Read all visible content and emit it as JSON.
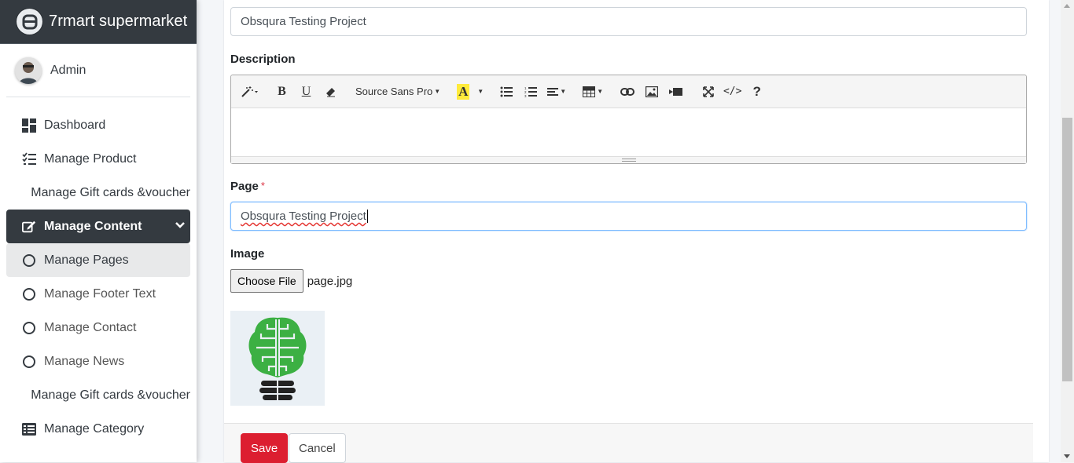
{
  "brand": {
    "name": "7rmart supermarket",
    "logo_icon": "brand-logo-icon"
  },
  "user": {
    "name": "Admin"
  },
  "sidebar": {
    "items": [
      {
        "label": "Dashboard",
        "icon": "dashboard-icon"
      },
      {
        "label": "Manage Product",
        "icon": "tasks-icon"
      },
      {
        "label": "Manage Gift cards &voucher",
        "icon": ""
      },
      {
        "label": "Manage Content",
        "icon": "edit-icon",
        "open": true
      },
      {
        "label": "Manage Pages",
        "icon": "circle-icon",
        "active": true
      },
      {
        "label": "Manage Footer Text",
        "icon": "circle-icon"
      },
      {
        "label": "Manage Contact",
        "icon": "circle-icon"
      },
      {
        "label": "Manage News",
        "icon": "circle-icon"
      },
      {
        "label": "Manage Gift cards &voucher",
        "icon": ""
      },
      {
        "label": "Manage Category",
        "icon": "list-icon"
      }
    ]
  },
  "form": {
    "title_value": "Obsqura Testing Project",
    "description_label": "Description",
    "editor": {
      "font_name": "Source Sans Pro",
      "tools": [
        "magic-icon",
        "bold-icon",
        "underline-icon",
        "eraser-icon",
        "font-name",
        "text-color-icon",
        "unordered-list-icon",
        "ordered-list-icon",
        "align-icon",
        "table-icon",
        "link-icon",
        "picture-icon",
        "video-icon",
        "fullscreen-icon",
        "code-view-icon",
        "help-icon"
      ]
    },
    "page_label": "Page",
    "page_required": "*",
    "page_value": "Obsqura Testing Project",
    "image_label": "Image",
    "choose_file_label": "Choose File",
    "file_name": "page.jpg",
    "save_label": "Save",
    "cancel_label": "Cancel"
  },
  "colors": {
    "sidebar_dark": "#343a40",
    "save_button": "#dc1e30",
    "thumbnail_brain": "#3cb043"
  }
}
